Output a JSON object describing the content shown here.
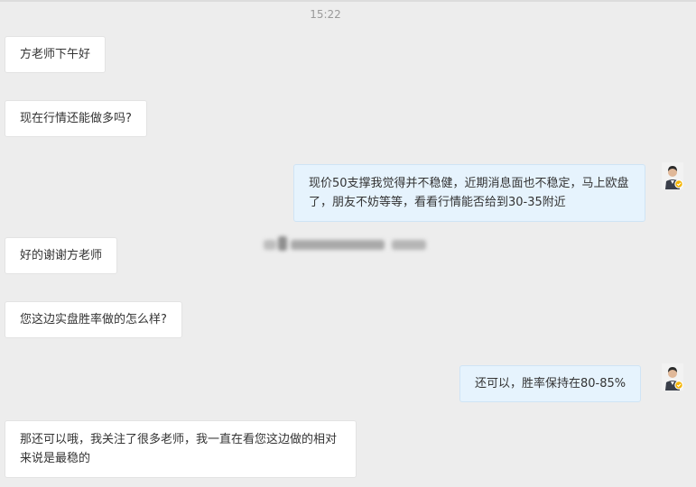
{
  "chat": {
    "timestamp": "15:22",
    "messages": [
      {
        "side": "left",
        "text": "方老师下午好"
      },
      {
        "side": "left",
        "text": "现在行情还能做多吗?"
      },
      {
        "side": "right",
        "text": "现价50支撑我觉得并不稳健，近期消息面也不稳定，马上欧盘了，朋友不妨等等，看看行情能否给到30-35附近"
      },
      {
        "side": "left",
        "text": "好的谢谢方老师"
      },
      {
        "side": "left",
        "text": "您这边实盘胜率做的怎么样?"
      },
      {
        "side": "right",
        "text": "还可以，胜率保持在80-85%"
      },
      {
        "side": "left",
        "text": "那还可以哦，我关注了很多老师，我一直在看您这边做的相对来说是最稳的"
      }
    ]
  },
  "avatar": {
    "icon": "user-avatar-icon",
    "badge_color": "#f5b400"
  },
  "colors": {
    "background": "#ededed",
    "left_bubble": "#ffffff",
    "right_bubble": "#e6f3fd"
  }
}
